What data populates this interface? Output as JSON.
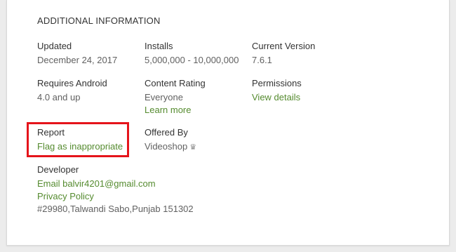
{
  "section_title": "ADDITIONAL INFORMATION",
  "updated": {
    "label": "Updated",
    "value": "December 24, 2017"
  },
  "installs": {
    "label": "Installs",
    "value": "5,000,000 - 10,000,000"
  },
  "current_version": {
    "label": "Current Version",
    "value": "7.6.1"
  },
  "requires_android": {
    "label": "Requires Android",
    "value": "4.0 and up"
  },
  "content_rating": {
    "label": "Content Rating",
    "value": "Everyone",
    "link": "Learn more"
  },
  "permissions": {
    "label": "Permissions",
    "link": "View details"
  },
  "report": {
    "label": "Report",
    "link": "Flag as inappropriate"
  },
  "offered_by": {
    "label": "Offered By",
    "value": "Videoshop",
    "icon": "crown-icon"
  },
  "developer": {
    "label": "Developer",
    "email_link": "Email balvir4201@gmail.com",
    "privacy_link": "Privacy Policy",
    "address": "#29980,Talwandi Sabo,Punjab 151302"
  },
  "colors": {
    "link": "#558b2f",
    "highlight_border": "#e5141b",
    "label": "#333333",
    "value": "#616161"
  }
}
